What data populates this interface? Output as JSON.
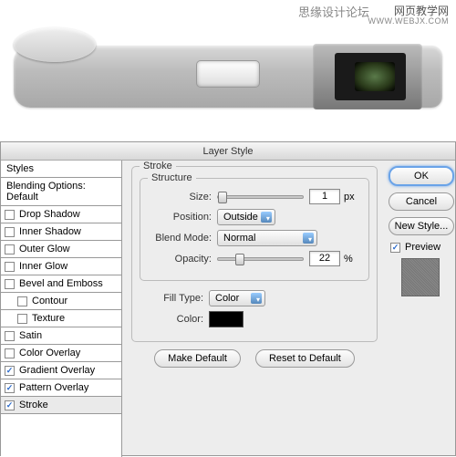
{
  "watermark": {
    "cn": "思缘设计论坛",
    "url": "网页教学网",
    "urlh": "WWW.WEBJX.COM"
  },
  "dialog": {
    "title": "Layer Style",
    "sidebar": {
      "header": "Styles",
      "blending": "Blending Options: Default",
      "items": [
        {
          "label": "Drop Shadow",
          "checked": false,
          "indent": false
        },
        {
          "label": "Inner Shadow",
          "checked": false,
          "indent": false
        },
        {
          "label": "Outer Glow",
          "checked": false,
          "indent": false
        },
        {
          "label": "Inner Glow",
          "checked": false,
          "indent": false
        },
        {
          "label": "Bevel and Emboss",
          "checked": false,
          "indent": false
        },
        {
          "label": "Contour",
          "checked": false,
          "indent": true
        },
        {
          "label": "Texture",
          "checked": false,
          "indent": true
        },
        {
          "label": "Satin",
          "checked": false,
          "indent": false
        },
        {
          "label": "Color Overlay",
          "checked": false,
          "indent": false
        },
        {
          "label": "Gradient Overlay",
          "checked": true,
          "indent": false
        },
        {
          "label": "Pattern Overlay",
          "checked": true,
          "indent": false
        },
        {
          "label": "Stroke",
          "checked": true,
          "indent": false,
          "selected": true
        }
      ]
    },
    "panel": {
      "title": "Stroke",
      "structure": {
        "legend": "Structure",
        "size": {
          "label": "Size:",
          "value": "1",
          "unit": "px",
          "pos": 1
        },
        "position": {
          "label": "Position:",
          "value": "Outside"
        },
        "blendmode": {
          "label": "Blend Mode:",
          "value": "Normal"
        },
        "opacity": {
          "label": "Opacity:",
          "value": "22",
          "unit": "%",
          "pos": 22
        }
      },
      "fill": {
        "label": "Fill Type:",
        "value": "Color",
        "colorLabel": "Color:",
        "color": "#000000"
      },
      "buttons": {
        "makeDefault": "Make Default",
        "reset": "Reset to Default"
      }
    },
    "right": {
      "ok": "OK",
      "cancel": "Cancel",
      "newstyle": "New Style...",
      "preview": {
        "label": "Preview",
        "checked": true
      }
    }
  }
}
